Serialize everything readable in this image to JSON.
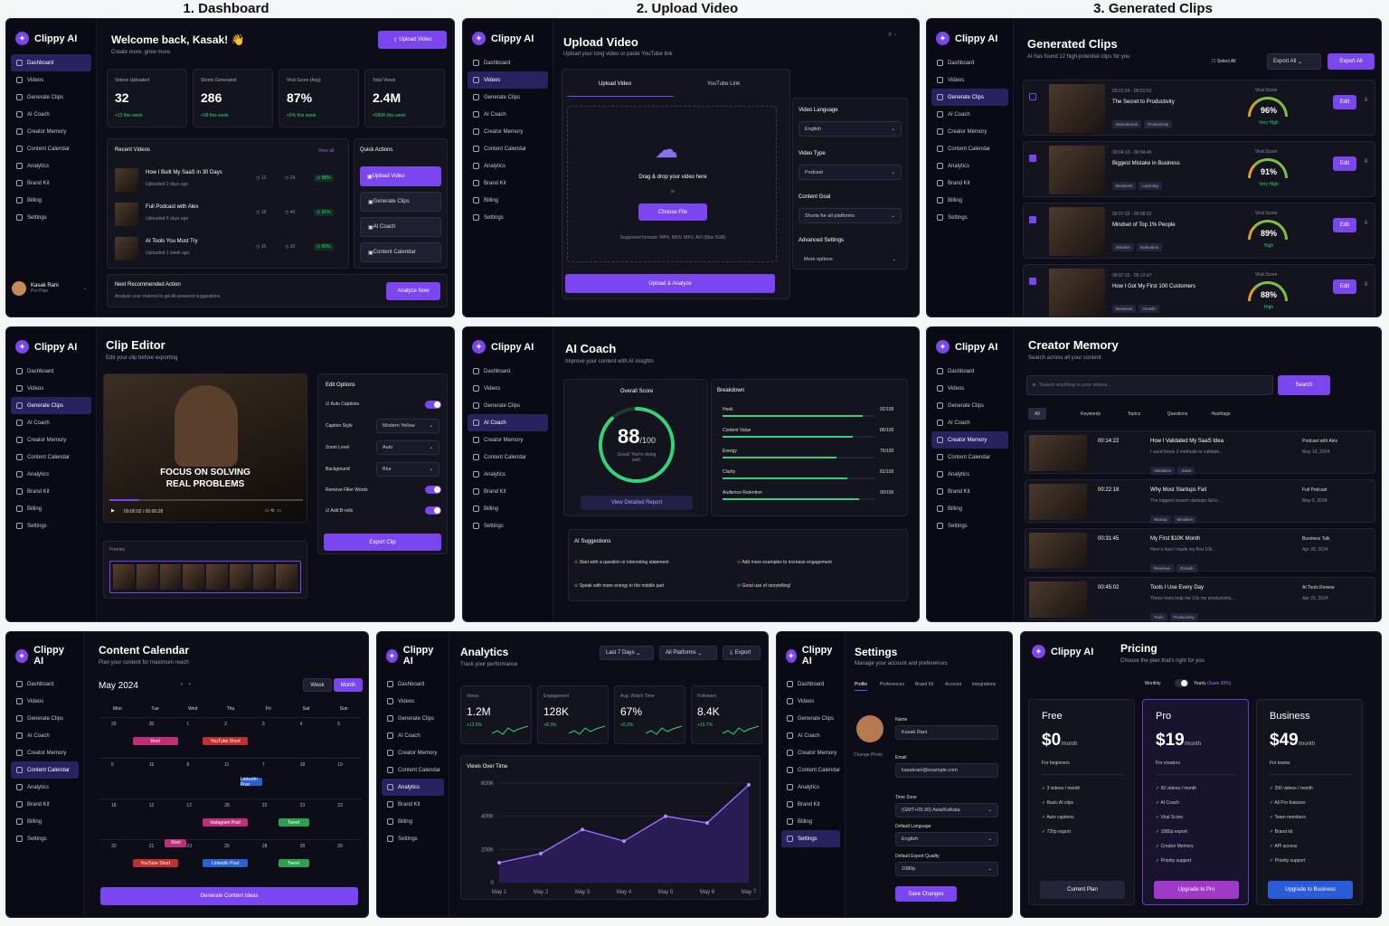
{
  "sections": {
    "dashboard": "1. Dashboard",
    "upload": "2. Upload Video",
    "clips": "3. Generated Clips"
  },
  "app": {
    "name": "Clippy AI"
  },
  "nav": [
    "Dashboard",
    "Videos",
    "Generate Clips",
    "AI Coach",
    "Creator Memory",
    "Content Calendar",
    "Analytics",
    "Brand Kit",
    "Billing",
    "Settings"
  ],
  "dashboard": {
    "title": "Welcome back, Kasak! 👋",
    "subtitle": "Create more, grow more.",
    "upload_btn": "Upload Video",
    "stats": [
      {
        "label": "Videos Uploaded",
        "value": "32",
        "delta": "+12 this week"
      },
      {
        "label": "Shorts Generated",
        "value": "286",
        "delta": "+98 this week"
      },
      {
        "label": "Viral Score (Avg)",
        "value": "87%",
        "delta": "+5% this week"
      },
      {
        "label": "Total Views",
        "value": "2.4M",
        "delta": "+580K this week"
      }
    ],
    "recent_title": "Recent Videos",
    "view_all": "View all",
    "recent": [
      {
        "title": "How I Built My SaaS in 30 Days",
        "meta": "Uploaded 2 days ago",
        "a": "12",
        "b": "24",
        "s": "88%"
      },
      {
        "title": "Full Podcast with Alex",
        "meta": "Uploaded 5 days ago",
        "a": "18",
        "b": "40",
        "s": "91%"
      },
      {
        "title": "AI Tools You Must Try",
        "meta": "Uploaded 1 week ago",
        "a": "15",
        "b": "33",
        "s": "82%"
      }
    ],
    "quick_title": "Quick Actions",
    "quick": [
      "Upload Video",
      "Generate Clips",
      "AI Coach",
      "Content Calendar"
    ],
    "next_title": "Next Recommended Action",
    "next_sub": "Analyze your channel to get AI-powered suggestions",
    "analyze": "Analyze Now",
    "user": {
      "name": "Kasak Rani",
      "plan": "Pro Plan"
    }
  },
  "upload": {
    "title": "Upload Video",
    "subtitle": "Upload your long video or paste YouTube link",
    "tabs": [
      "Upload Video",
      "YouTube Link"
    ],
    "drop": "Drag & drop your video here",
    "or": "or",
    "choose": "Choose File",
    "formats": "Supported formats: MP4, MOV, MKV, AVI (Max 5GB)",
    "upload_btn": "Upload & Analyze",
    "fields": [
      {
        "label": "Video Language",
        "value": "English"
      },
      {
        "label": "Video Type",
        "value": "Podcast"
      },
      {
        "label": "Content Goal",
        "value": "Shorts for all platforms"
      },
      {
        "label": "Advanced Settings",
        "value": "More options"
      }
    ]
  },
  "clips": {
    "title": "Generated Clips",
    "subtitle": "AI has found 12 high-potential clips for you",
    "select_all": "Select All",
    "export_all": "Export All",
    "export_btn": "Export All",
    "items": [
      {
        "time": "00:01:24 - 00:01:52",
        "title": "The Secret to Productivity",
        "tags": [
          "Motivational",
          "Productivity"
        ],
        "score": "96%",
        "label": "Very High"
      },
      {
        "time": "00:04:10 - 00:04:45",
        "title": "Biggest Mistake in Business",
        "tags": [
          "Business",
          "Learning"
        ],
        "score": "91%",
        "label": "Very High"
      },
      {
        "time": "00:07:33 - 00:08:02",
        "title": "Mindset of Top 1% People",
        "tags": [
          "Mindset",
          "Motivation"
        ],
        "score": "89%",
        "label": "High"
      },
      {
        "time": "00:07:15 - 00:12:47",
        "title": "How I Got My First 100 Customers",
        "tags": [
          "Business",
          "Growth"
        ],
        "score": "88%",
        "label": "High"
      }
    ],
    "viral": "Viral Score",
    "edit": "Edit"
  },
  "editor": {
    "title": "Clip Editor",
    "subtitle": "Edit your clip before exporting",
    "caption": "FOCUS ON SOLVING REAL PROBLEMS",
    "time": "00:00:02 / 00:00:28",
    "opts_title": "Edit Options",
    "auto": "Auto Captions",
    "rows": [
      {
        "label": "Caption Style",
        "value": "Modern Yellow"
      },
      {
        "label": "Zoom Level",
        "value": "Auto"
      },
      {
        "label": "Background",
        "value": "Blur"
      }
    ],
    "filler": "Remove Filler Words",
    "broll": "Add B-rolls",
    "export": "Export Clip",
    "frames": "Frames"
  },
  "coach": {
    "title": "AI Coach",
    "subtitle": "Improve your content with AI insights",
    "overall": "Overall Score",
    "score": "88",
    "out": "/100",
    "score_sub": "Great! You're doing well.",
    "report": "View Detailed Report",
    "breakdown_title": "Breakdown",
    "breakdown": [
      {
        "label": "Hook",
        "v": "92/100",
        "p": 0.92
      },
      {
        "label": "Content Value",
        "v": "86/100",
        "p": 0.86
      },
      {
        "label": "Energy",
        "v": "75/100",
        "p": 0.75
      },
      {
        "label": "Clarity",
        "v": "82/100",
        "p": 0.82
      },
      {
        "label": "Audience Retention",
        "v": "90/100",
        "p": 0.9
      }
    ],
    "sugg_title": "AI Suggestions",
    "sugg": [
      "Start with a question or interesting statement",
      "Add more examples to increase engagement",
      "Speak with more energy in the middle part",
      "Good use of storytelling!"
    ]
  },
  "memory": {
    "title": "Creator Memory",
    "subtitle": "Search across all your content",
    "placeholder": "Search anything in your videos...",
    "search": "Search",
    "filters": [
      "All",
      "Keywords",
      "Topics",
      "Questions",
      "Hashtags"
    ],
    "items": [
      {
        "t": "00:14:22",
        "title": "How I Validated My SaaS Idea",
        "desc": "I used these 3 methods to validate...",
        "tags": [
          "Validation",
          "SaaS"
        ],
        "src": "Podcast with Alex",
        "date": "May 10, 2024"
      },
      {
        "t": "00:22:18",
        "title": "Why Most Startups Fail",
        "desc": "The biggest reason startups fail is...",
        "tags": [
          "Startup",
          "Mistakes"
        ],
        "src": "Full Podcast",
        "date": "May 5, 2024"
      },
      {
        "t": "00:31:45",
        "title": "My First $10K Month",
        "desc": "Here's how I made my first 10k...",
        "tags": [
          "Revenue",
          "Growth"
        ],
        "src": "Business Talk",
        "date": "Apr 28, 2024"
      },
      {
        "t": "00:45:02",
        "title": "Tools I Use Every Day",
        "desc": "These tools help me 10x my productivity...",
        "tags": [
          "Tools",
          "Productivity"
        ],
        "src": "AI Tools Review",
        "date": "Apr 20, 2024"
      }
    ]
  },
  "calendar": {
    "title": "Content Calendar",
    "subtitle": "Plan your content for maximum reach",
    "month": "May 2024",
    "week": "Week",
    "month_btn": "Month",
    "days": [
      "Mon",
      "Tue",
      "Wed",
      "Thu",
      "Fri",
      "Sat",
      "Sun"
    ],
    "dates": [
      "29",
      "30",
      "1",
      "2",
      "3",
      "4",
      "5",
      "5",
      "16",
      "8",
      "11",
      "7",
      "18",
      "19",
      "18",
      "12",
      "12",
      "28",
      "22",
      "23",
      "23",
      "20",
      "21",
      "23",
      "29",
      "28",
      "28",
      "29"
    ],
    "events": [
      "Reel",
      "YouTube Short",
      "LinkedIn Post",
      "Instagram Post",
      "Tweet",
      "Reel",
      "YouTube Short",
      "LinkedIn Post",
      "Tweet"
    ],
    "generate": "Generate Content Ideas"
  },
  "analytics": {
    "title": "Analytics",
    "subtitle": "Track your performance",
    "range": "Last 7 Days",
    "platform": "All Platforms",
    "export": "Export",
    "stats": [
      {
        "label": "Views",
        "value": "1.2M",
        "delta": "+12.5%"
      },
      {
        "label": "Engagement",
        "value": "128K",
        "delta": "+8.3%"
      },
      {
        "label": "Avg. Watch Time",
        "value": "67%",
        "delta": "+5.2%"
      },
      {
        "label": "Followers",
        "value": "8.4K",
        "delta": "+15.7%"
      }
    ],
    "chart_title": "Views Over Time"
  },
  "chart_data": {
    "type": "area",
    "title": "Views Over Time",
    "x": [
      "May 1",
      "May 2",
      "May 3",
      "May 4",
      "May 5",
      "May 6",
      "May 7"
    ],
    "series": [
      {
        "values": [
          120000,
          175000,
          320000,
          250000,
          400000,
          360000,
          590000
        ]
      }
    ],
    "y_ticks": [
      "0",
      "200K",
      "400K",
      "600K"
    ],
    "ylim": [
      0,
      600000
    ]
  },
  "settings": {
    "title": "Settings",
    "subtitle": "Manage your account and preferences",
    "tabs": [
      "Profile",
      "Preferences",
      "Brand Kit",
      "Account",
      "Integrations"
    ],
    "change": "Change Photo",
    "fields": [
      {
        "label": "Name",
        "value": "Kasak Rani"
      },
      {
        "label": "Email",
        "value": "kasakrani@example.com"
      },
      {
        "label": "Time Zone",
        "value": "(GMT+05:30) Asia/Kolkata"
      },
      {
        "label": "Default Language",
        "value": "English"
      },
      {
        "label": "Default Export Quality",
        "value": "1080p"
      }
    ],
    "save": "Save Changes"
  },
  "pricing": {
    "title": "Pricing",
    "subtitle": "Choose the plan that's right for you",
    "monthly": "Monthly",
    "yearly": "Yearly",
    "save": "(Save 20%)",
    "plans": [
      {
        "name": "Free",
        "price": "$0",
        "per": "/month",
        "for": "For beginners",
        "features": [
          "3 videos / month",
          "Basic AI clips",
          "Auto captions",
          "720p export"
        ],
        "btn": "Current Plan"
      },
      {
        "name": "Pro",
        "price": "$19",
        "per": "/month",
        "for": "For creators",
        "features": [
          "50 videos / month",
          "AI Coach",
          "Viral Score",
          "1080p export",
          "Creator Memory",
          "Priority support"
        ],
        "btn": "Upgrade to Pro"
      },
      {
        "name": "Business",
        "price": "$49",
        "per": "/month",
        "for": "For teams",
        "features": [
          "200 videos / month",
          "All Pro features",
          "Team members",
          "Brand kit",
          "API access",
          "Priority support"
        ],
        "btn": "Upgrade to Business"
      }
    ]
  },
  "colors": {
    "accent": "#7b46f0",
    "bg": "#0d0d18",
    "green": "#36d27a"
  }
}
